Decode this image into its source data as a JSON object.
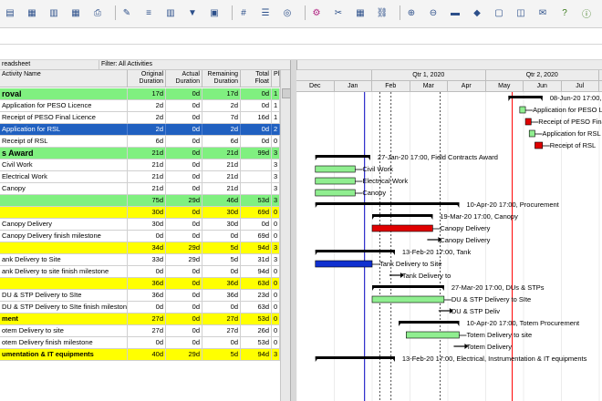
{
  "colors": {
    "wbs_green": "#80f080",
    "wbs_yellow": "#ffff00",
    "selected": "#2060c0",
    "bar_green": "#90ee90",
    "bar_red": "#e00000",
    "bar_blue": "#1030d0",
    "summary": "#000000",
    "datadate_line": "#ff0000"
  },
  "toolbar": {
    "icons": [
      "layout-icon",
      "grid-icon",
      "chart-icon",
      "table-icon",
      "print-icon",
      "brush-icon",
      "sort-icon",
      "columns-icon",
      "filter-icon",
      "group-icon",
      "hash-icon",
      "list-icon",
      "globe-icon",
      "network-icon",
      "split-icon",
      "calendar-icon",
      "link-icon",
      "zoom-in-icon",
      "zoom-out-icon",
      "bar-icon",
      "diamond-icon",
      "box-icon",
      "comment-icon",
      "note-icon",
      "help-icon",
      "info-icon"
    ]
  },
  "sheet": {
    "title": "readsheet",
    "filter": "Filter: All Activities",
    "columns": [
      {
        "key": "name",
        "label": "Activity Name"
      },
      {
        "key": "orig",
        "label": "Original Duration"
      },
      {
        "key": "actual",
        "label": "Actual Duration"
      },
      {
        "key": "rem",
        "label": "Remaining Duration"
      },
      {
        "key": "float",
        "label": "Total Float"
      },
      {
        "key": "pct",
        "label": "Pl"
      }
    ],
    "rows": [
      {
        "type": "wbs1",
        "name": "roval",
        "orig": "17d",
        "actual": "0d",
        "rem": "17d",
        "float": "0d",
        "pct": "1"
      },
      {
        "type": "act",
        "name": "Application for PESO Licence",
        "orig": "2d",
        "actual": "0d",
        "rem": "2d",
        "float": "0d",
        "pct": "1"
      },
      {
        "type": "act",
        "name": "Receipt of PESO Final Licence",
        "orig": "2d",
        "actual": "0d",
        "rem": "7d",
        "float": "16d",
        "pct": "1"
      },
      {
        "type": "sel",
        "name": "Application for RSL",
        "orig": "2d",
        "actual": "0d",
        "rem": "2d",
        "float": "0d",
        "pct": "2"
      },
      {
        "type": "act",
        "name": "Receipt of RSL",
        "orig": "6d",
        "actual": "0d",
        "rem": "6d",
        "float": "0d",
        "pct": "0"
      },
      {
        "type": "wbs1",
        "name": "s Award",
        "orig": "21d",
        "actual": "0d",
        "rem": "21d",
        "float": "99d",
        "pct": "3"
      },
      {
        "type": "act",
        "name": "Civil Work",
        "orig": "21d",
        "actual": "0d",
        "rem": "21d",
        "float": "",
        "pct": "3"
      },
      {
        "type": "act",
        "name": "Electrical Work",
        "orig": "21d",
        "actual": "0d",
        "rem": "21d",
        "float": "",
        "pct": "3"
      },
      {
        "type": "act",
        "name": "Canopy",
        "orig": "21d",
        "actual": "0d",
        "rem": "21d",
        "float": "",
        "pct": "3"
      },
      {
        "type": "wbs1",
        "name": "",
        "orig": "75d",
        "actual": "29d",
        "rem": "46d",
        "float": "53d",
        "pct": "3"
      },
      {
        "type": "wbs2",
        "name": "",
        "orig": "30d",
        "actual": "0d",
        "rem": "30d",
        "float": "69d",
        "pct": "0"
      },
      {
        "type": "act",
        "name": "Canopy Delivery",
        "orig": "30d",
        "actual": "0d",
        "rem": "30d",
        "float": "0d",
        "pct": "0"
      },
      {
        "type": "act",
        "name": "Canopy Delivery finish milestone",
        "orig": "0d",
        "actual": "0d",
        "rem": "0d",
        "float": "69d",
        "pct": "0"
      },
      {
        "type": "wbs2",
        "name": "",
        "orig": "34d",
        "actual": "29d",
        "rem": "5d",
        "float": "94d",
        "pct": "3"
      },
      {
        "type": "act",
        "name": "ank Delivery to Site",
        "orig": "33d",
        "actual": "29d",
        "rem": "5d",
        "float": "31d",
        "pct": "3"
      },
      {
        "type": "act",
        "name": "ank Delivery to site finish milestone",
        "orig": "0d",
        "actual": "0d",
        "rem": "0d",
        "float": "94d",
        "pct": "0"
      },
      {
        "type": "wbs2",
        "name": "",
        "orig": "36d",
        "actual": "0d",
        "rem": "36d",
        "float": "63d",
        "pct": "0"
      },
      {
        "type": "act",
        "name": "DU & STP Delivery to SIte",
        "orig": "36d",
        "actual": "0d",
        "rem": "36d",
        "float": "23d",
        "pct": "0"
      },
      {
        "type": "act",
        "name": "DU & STP Delivery to SIte finish mileston",
        "orig": "0d",
        "actual": "0d",
        "rem": "0d",
        "float": "63d",
        "pct": "0"
      },
      {
        "type": "wbs2",
        "name": "ment",
        "orig": "27d",
        "actual": "0d",
        "rem": "27d",
        "float": "53d",
        "pct": "0"
      },
      {
        "type": "act",
        "name": "otem Delivery to site",
        "orig": "27d",
        "actual": "0d",
        "rem": "27d",
        "float": "26d",
        "pct": "0"
      },
      {
        "type": "act",
        "name": "otem Delivery finish milestone",
        "orig": "0d",
        "actual": "0d",
        "rem": "0d",
        "float": "53d",
        "pct": "0"
      },
      {
        "type": "wbs2",
        "name": "umentation & IT equipments",
        "orig": "40d",
        "actual": "29d",
        "rem": "5d",
        "float": "94d",
        "pct": "3"
      }
    ]
  },
  "gantt": {
    "quarters": [
      {
        "label": "",
        "start": 0,
        "end": 2
      },
      {
        "label": "Qtr 1, 2020",
        "start": 2,
        "end": 5
      },
      {
        "label": "Qtr 2, 2020",
        "start": 5,
        "end": 8
      },
      {
        "label": "Qtr",
        "start": 8,
        "end": 9
      }
    ],
    "months": [
      "Dec",
      "Jan",
      "Feb",
      "Mar",
      "Apr",
      "May",
      "Jun",
      "Jul"
    ],
    "data_date": 5.7,
    "tasks": [
      {
        "kind": "summary",
        "start": 5.6,
        "end": 6.5,
        "label": "08-Jun-20 17:00, Sata"
      },
      {
        "kind": "bar",
        "color": "green",
        "start": 5.9,
        "end": 6.05,
        "label": "Application for PESO Licence"
      },
      {
        "kind": "bar",
        "color": "red",
        "start": 6.05,
        "end": 6.2,
        "label": "Receipt of PESO Final Licence"
      },
      {
        "kind": "bar",
        "color": "green",
        "start": 6.15,
        "end": 6.3,
        "label": "Application for RSL"
      },
      {
        "kind": "bar",
        "color": "red",
        "start": 6.3,
        "end": 6.5,
        "label": "Receipt of RSL"
      },
      {
        "kind": "summary",
        "start": 0.5,
        "end": 1.95,
        "label": "27-Jan-20 17:00, Field Contracts Award"
      },
      {
        "kind": "bar",
        "color": "green",
        "start": 0.5,
        "end": 1.55,
        "label": "Civil Work"
      },
      {
        "kind": "bar",
        "color": "green",
        "start": 0.5,
        "end": 1.55,
        "label": "Electrical Work"
      },
      {
        "kind": "bar",
        "color": "green",
        "start": 0.5,
        "end": 1.55,
        "label": "Canopy"
      },
      {
        "kind": "summary",
        "start": 0.5,
        "end": 4.3,
        "label": "10-Apr-20 17:00, Procurement"
      },
      {
        "kind": "summary",
        "start": 2.0,
        "end": 3.6,
        "label": "19-Mar-20 17:00, Canopy"
      },
      {
        "kind": "bar",
        "color": "red",
        "start": 2.0,
        "end": 3.6,
        "label": "Canopy Delivery"
      },
      {
        "kind": "milestone",
        "start": 3.6,
        "end": 3.6,
        "label": "Canopy Delivery"
      },
      {
        "kind": "summary",
        "start": 0.5,
        "end": 2.6,
        "label": "13-Feb-20 17:00, Tank"
      },
      {
        "kind": "bar",
        "color": "blue",
        "start": 0.5,
        "end": 2.0,
        "label": "Tank Delivery to Site"
      },
      {
        "kind": "milestone",
        "start": 2.6,
        "end": 2.6,
        "label": "Tank Delivery to"
      },
      {
        "kind": "summary",
        "start": 2.0,
        "end": 3.9,
        "label": "27-Mar-20 17:00, DUs & STPs"
      },
      {
        "kind": "bar",
        "color": "green",
        "start": 2.0,
        "end": 3.9,
        "label": "DU & STP Delivery to SIte"
      },
      {
        "kind": "milestone",
        "start": 3.9,
        "end": 3.9,
        "label": "DU & STP Deliv"
      },
      {
        "kind": "summary",
        "start": 2.7,
        "end": 4.3,
        "label": "10-Apr-20 17:00, Totem Procurement"
      },
      {
        "kind": "bar",
        "color": "green",
        "start": 2.9,
        "end": 4.3,
        "label": "Totem Delivery to site"
      },
      {
        "kind": "milestone",
        "start": 4.3,
        "end": 4.3,
        "label": "Totem Delivery"
      },
      {
        "kind": "summary",
        "start": 0.5,
        "end": 2.6,
        "label": "13-Feb-20 17:00, Electrical, Instrumentation & IT equipments"
      }
    ]
  }
}
